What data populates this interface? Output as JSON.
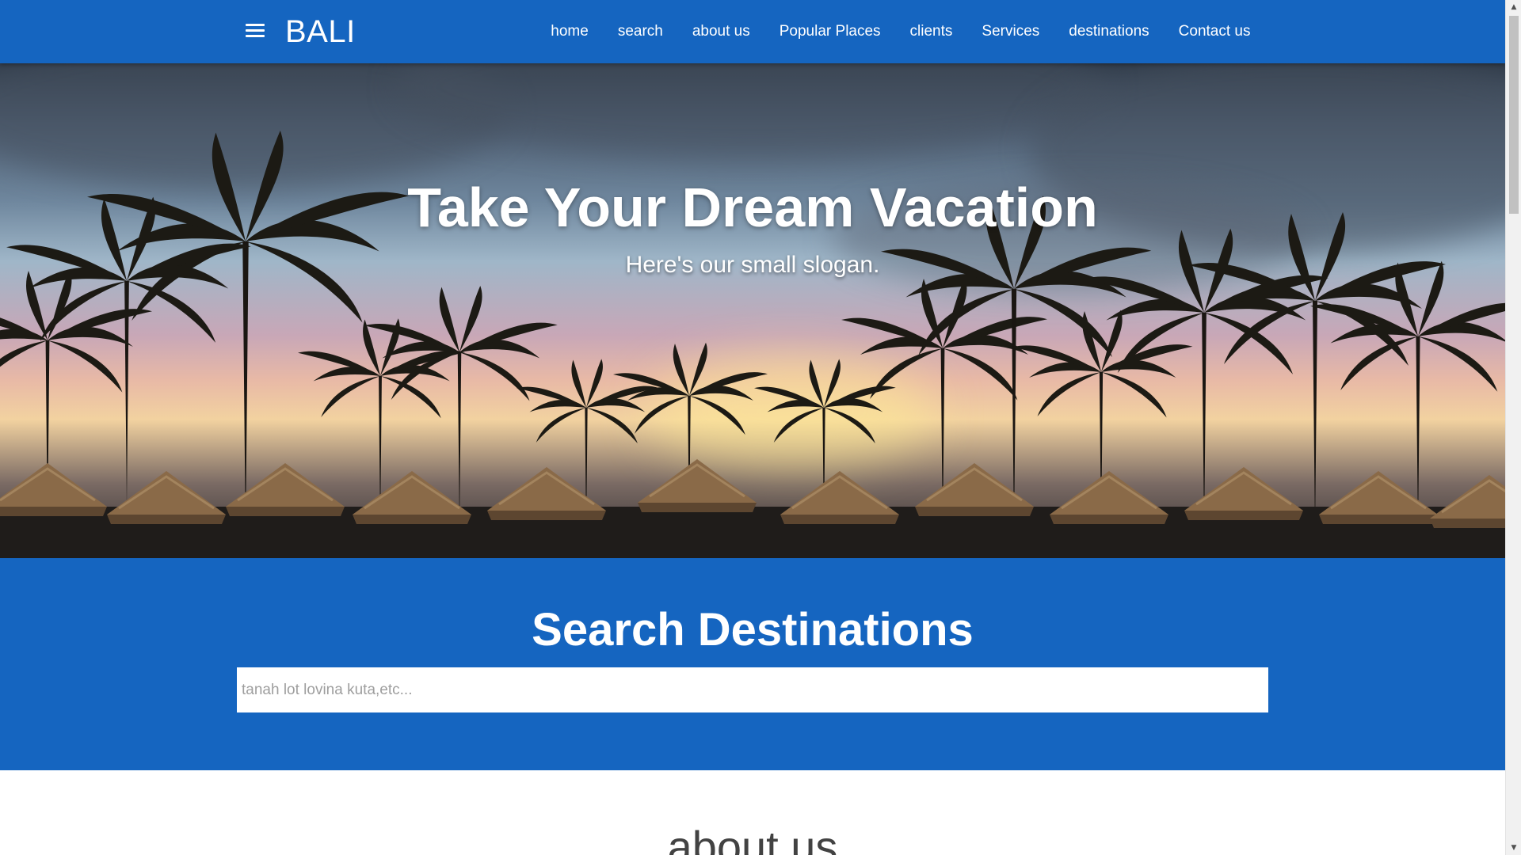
{
  "navbar": {
    "brand": "BALI",
    "links": [
      "home",
      "search",
      "about us",
      "Popular Places",
      "clients",
      "Services",
      "destinations",
      "Contact us"
    ]
  },
  "hero": {
    "title": "Take Your Dream Vacation",
    "slogan": "Here's our small slogan."
  },
  "search": {
    "title": "Search Destinations",
    "placeholder": "tanah lot lovina kuta,etc..."
  },
  "about": {
    "title": "about us"
  },
  "colors": {
    "primary": "#1565c0",
    "background": "#ffffff"
  },
  "icons": {
    "menu": "hamburger-menu-icon"
  }
}
